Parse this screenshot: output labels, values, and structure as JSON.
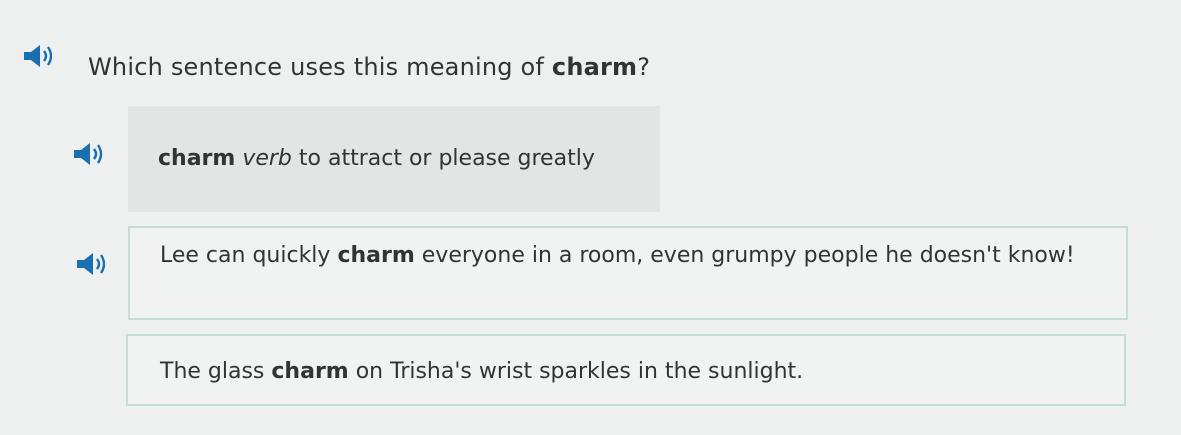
{
  "question": {
    "prefix": "Which sentence uses this meaning of ",
    "keyword": "charm",
    "suffix": "?",
    "icon": "speaker-icon"
  },
  "definition": {
    "word": "charm",
    "part_of_speech": "verb",
    "meaning": " to attract or please greatly",
    "icon": "speaker-icon"
  },
  "options": [
    {
      "before": "Lee can quickly ",
      "keyword": "charm",
      "after": " everyone in a room, even grumpy people he doesn't know!",
      "icon": "speaker-icon"
    },
    {
      "before": "The glass ",
      "keyword": "charm",
      "after": " on Trisha's wrist sparkles in the sunlight."
    }
  ],
  "colors": {
    "speaker_blue": "#1a6fb0",
    "option_border": "#c4ddd7",
    "definition_bg": "#e2e5e4"
  }
}
